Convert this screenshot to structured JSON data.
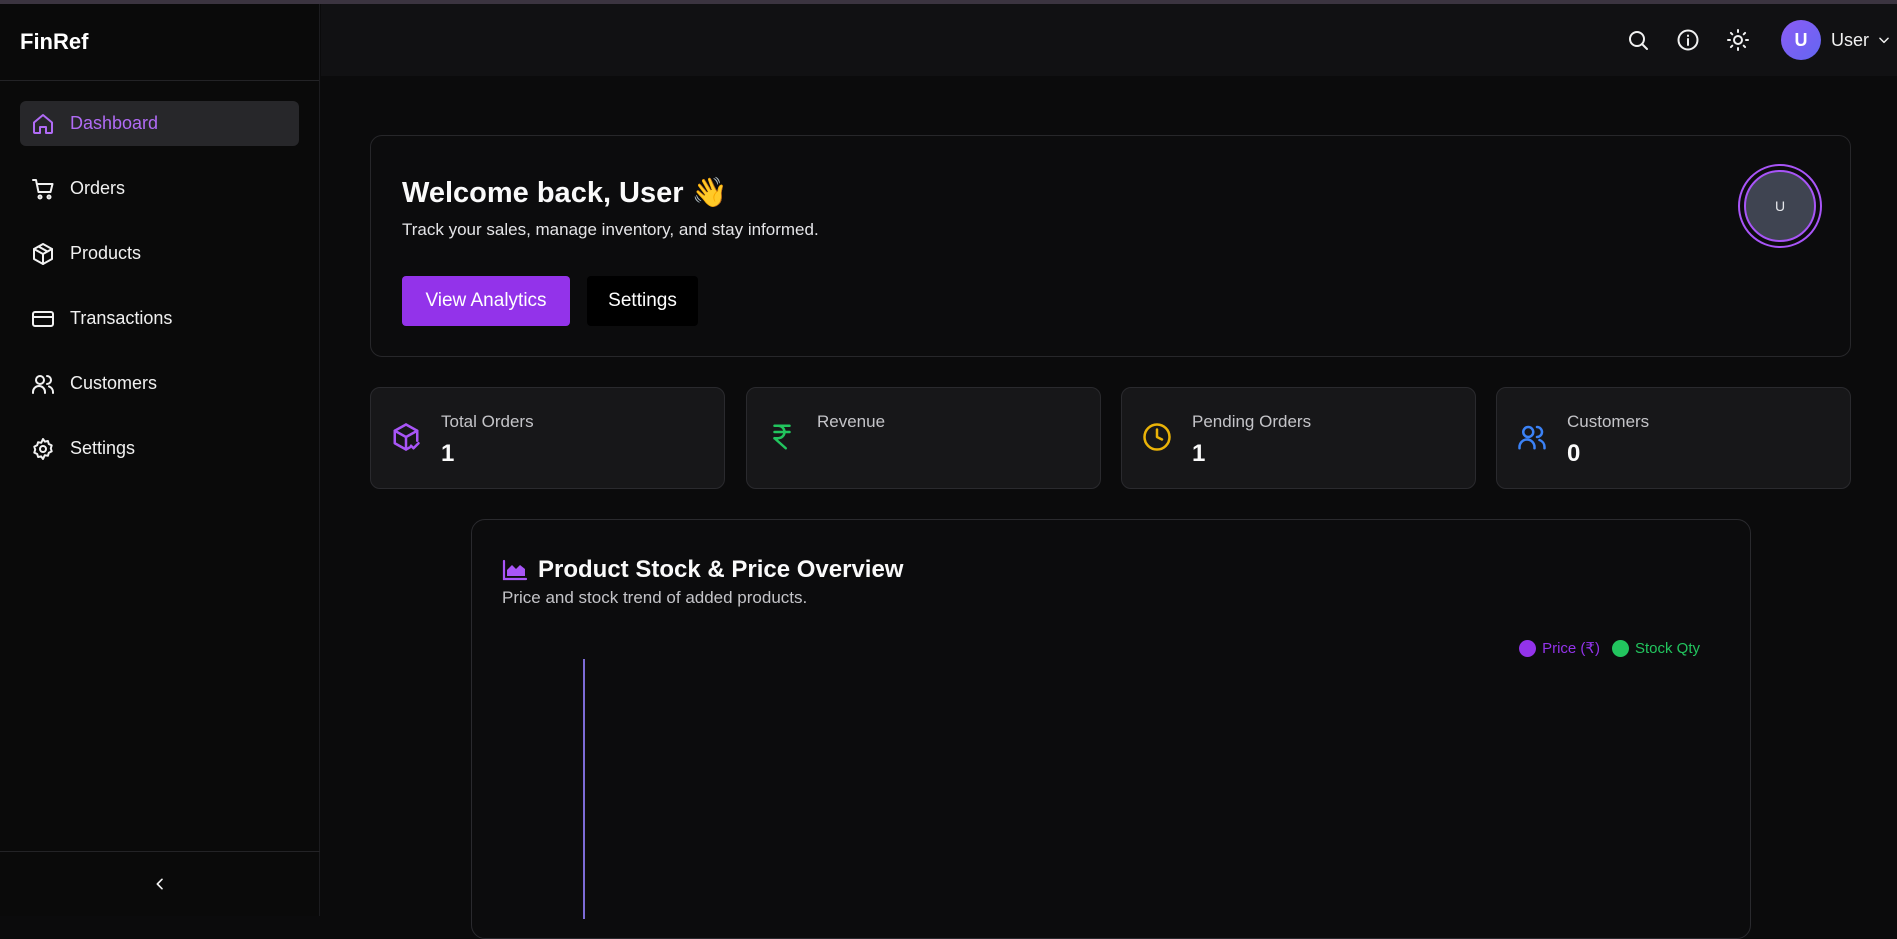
{
  "brand": "FinRef",
  "sidebar": {
    "items": [
      {
        "label": "Dashboard",
        "icon": "home-icon",
        "active": true
      },
      {
        "label": "Orders",
        "icon": "cart-icon"
      },
      {
        "label": "Products",
        "icon": "package-icon"
      },
      {
        "label": "Transactions",
        "icon": "credit-card-icon"
      },
      {
        "label": "Customers",
        "icon": "users-icon"
      },
      {
        "label": "Settings",
        "icon": "gear-icon"
      }
    ]
  },
  "header": {
    "user_initial": "U",
    "user_name": "User"
  },
  "welcome": {
    "title": "Welcome back, User 👋",
    "subtitle": "Track your sales, manage inventory, and stay informed.",
    "primary_button": "View Analytics",
    "secondary_button": "Settings",
    "avatar_initial": "U"
  },
  "stats": [
    {
      "label": "Total Orders",
      "value": "1",
      "icon": "package-check-icon",
      "color": "#a855f7"
    },
    {
      "label": "Revenue",
      "value": "",
      "icon": "rupee-icon",
      "color": "#22c55e"
    },
    {
      "label": "Pending Orders",
      "value": "1",
      "icon": "clock-icon",
      "color": "#eab308"
    },
    {
      "label": "Customers",
      "value": "0",
      "icon": "users-icon",
      "color": "#3b82f6"
    }
  ],
  "chart": {
    "title": "Product Stock & Price Overview",
    "subtitle": "Price and stock trend of added products.",
    "legend": [
      {
        "name": "Price (₹)",
        "color": "#9333ea"
      },
      {
        "name": "Stock Qty",
        "color": "#22c55e"
      }
    ]
  },
  "chart_data": {
    "type": "area",
    "title": "Product Stock & Price Overview",
    "series": [
      {
        "name": "Price (₹)",
        "values": []
      },
      {
        "name": "Stock Qty",
        "values": []
      }
    ],
    "legend_position": "top-right",
    "grid": false
  },
  "colors": {
    "accent": "#9333ea",
    "accent_text": "#b06bf5",
    "background": "#0b0b0c"
  }
}
